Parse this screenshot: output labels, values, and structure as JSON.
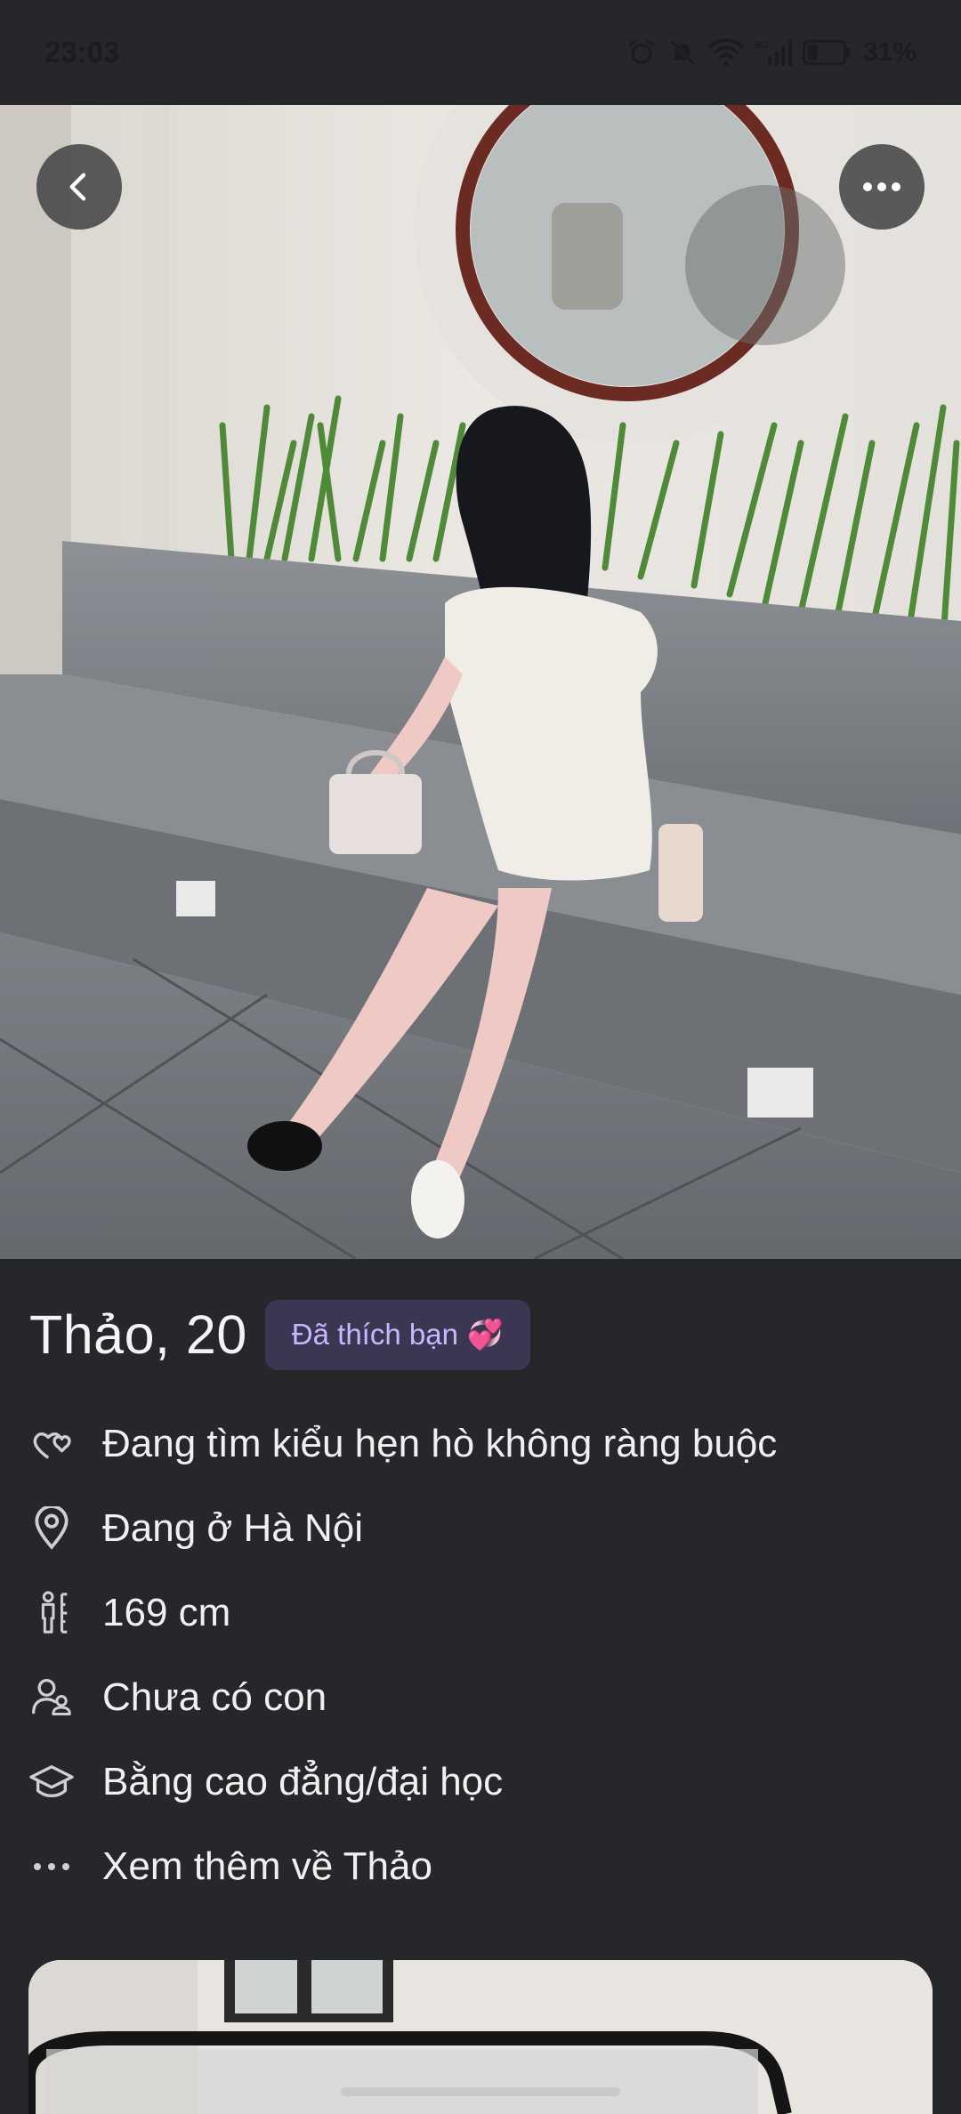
{
  "status_bar": {
    "time": "23:03",
    "battery": "31%",
    "icons": [
      "alarm-icon",
      "mute-icon",
      "wifi-icon",
      "5g-signal-icon",
      "battery-icon"
    ]
  },
  "photo": {
    "alt": "Profile photo"
  },
  "profile": {
    "name_age": "Thảo, 20",
    "liked_badge": "Đã thích bạn",
    "liked_emoji": "💞"
  },
  "attributes": [
    {
      "icon": "hearts-icon",
      "text": "Đang tìm kiểu hẹn hò không ràng buộc"
    },
    {
      "icon": "location-pin-icon",
      "text": "Đang ở Hà Nội"
    },
    {
      "icon": "height-icon",
      "text": "169 cm"
    },
    {
      "icon": "children-icon",
      "text": "Chưa có con"
    },
    {
      "icon": "education-icon",
      "text": "Bằng cao đẳng/đại học"
    },
    {
      "icon": "more-dots-icon",
      "text": "Xem thêm về Thảo"
    }
  ],
  "colors": {
    "background": "#26272b",
    "badge_bg": "#3b3651",
    "badge_text": "#c8b7ff"
  }
}
